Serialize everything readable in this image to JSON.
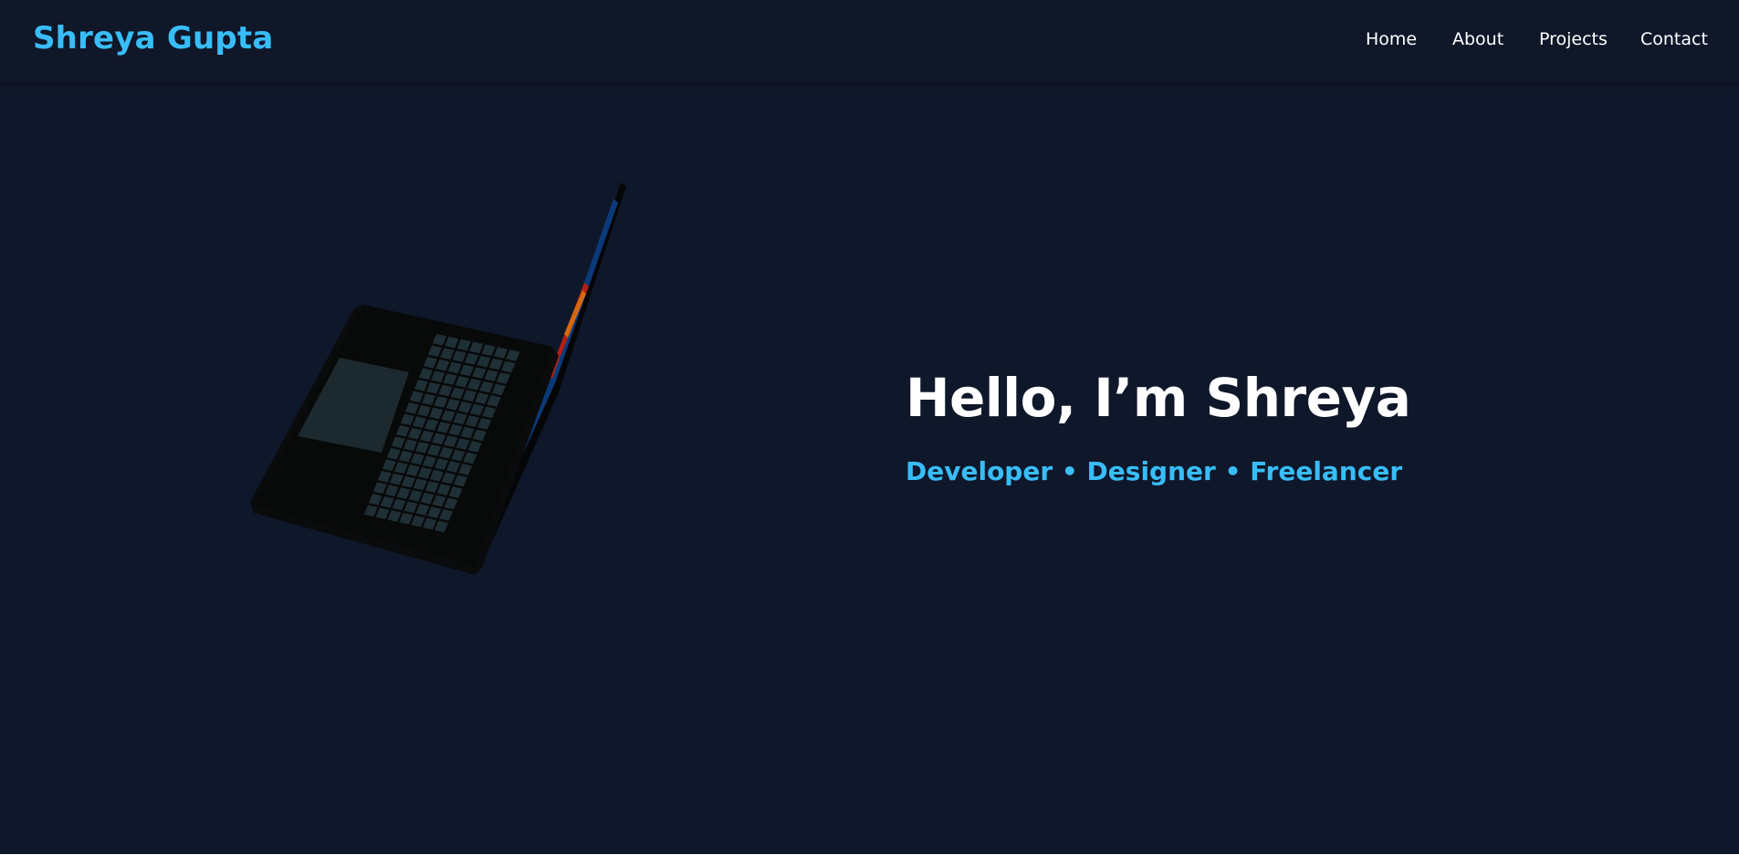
{
  "brand": {
    "name": "Shreya Gupta"
  },
  "nav": {
    "items": [
      {
        "label": "Home"
      },
      {
        "label": "About"
      },
      {
        "label": "Projects"
      },
      {
        "label": "Contact"
      }
    ]
  },
  "hero": {
    "title": "Hello, I’m Shreya",
    "subtitle": "Developer • Designer • Freelancer",
    "visual": "laptop-3d-model"
  },
  "colors": {
    "background": "#0f172a",
    "accent": "#38bdf8",
    "text": "#ffffff"
  }
}
